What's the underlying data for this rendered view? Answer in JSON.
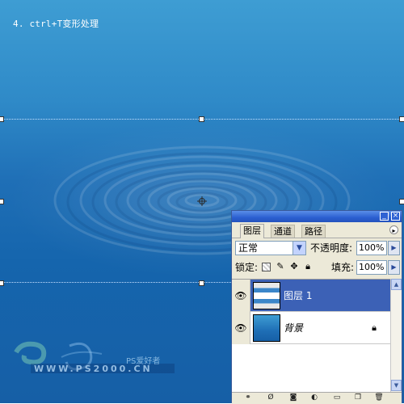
{
  "caption": "4. ctrl+T变形处理",
  "panel": {
    "tabs": [
      "图层",
      "通道",
      "路径"
    ],
    "blend_mode": "正常",
    "opacity_label": "不透明度:",
    "opacity_value": "100%",
    "lock_label": "锁定:",
    "fill_label": "填充:",
    "fill_value": "100%",
    "layers": [
      {
        "name": "图层 1",
        "selected": true,
        "visible": true
      },
      {
        "name": "背景",
        "selected": false,
        "visible": true,
        "locked": true
      }
    ],
    "bottom_icons": [
      "link-icon",
      "layer-style-icon",
      "mask-icon",
      "adjustment-icon",
      "folder-icon",
      "new-layer-icon",
      "trash-icon"
    ]
  },
  "watermark": {
    "brand": "PS爱好者",
    "url": "WWW.PS2000.CN"
  },
  "colors": {
    "selection_blue": "#3c61b6",
    "panel_bg": "#ece9d8",
    "titlebar": "#2b5fd0"
  }
}
